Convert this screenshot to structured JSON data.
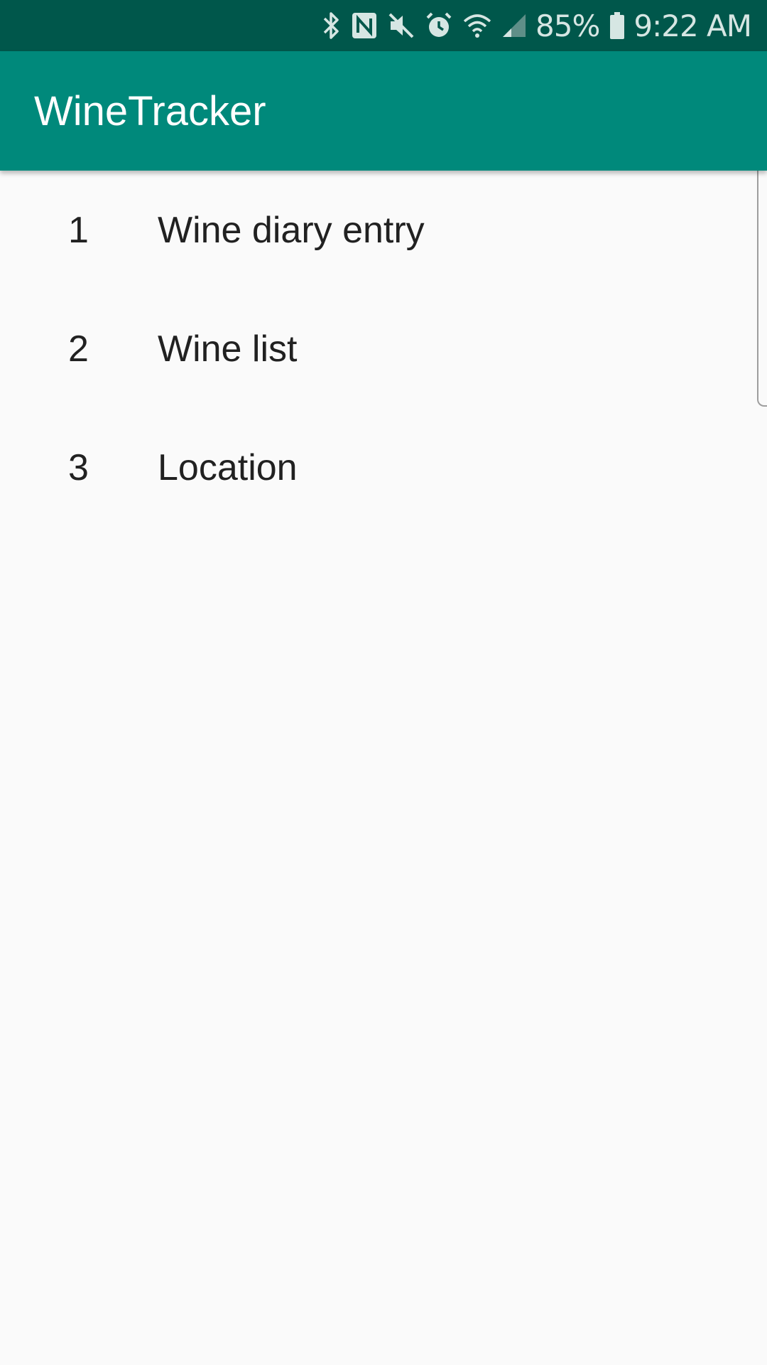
{
  "status_bar": {
    "icons": [
      "bluetooth-icon",
      "nfc-icon",
      "mute-icon",
      "alarm-icon",
      "wifi-icon",
      "signal-icon"
    ],
    "battery_percent": "85%",
    "time": "9:22 AM",
    "background_color": "#00574b"
  },
  "app_bar": {
    "title": "WineTracker",
    "background_color": "#00897b"
  },
  "list": {
    "items": [
      {
        "number": "1",
        "label": "Wine diary entry"
      },
      {
        "number": "2",
        "label": "Wine list"
      },
      {
        "number": "3",
        "label": "Location"
      }
    ]
  }
}
